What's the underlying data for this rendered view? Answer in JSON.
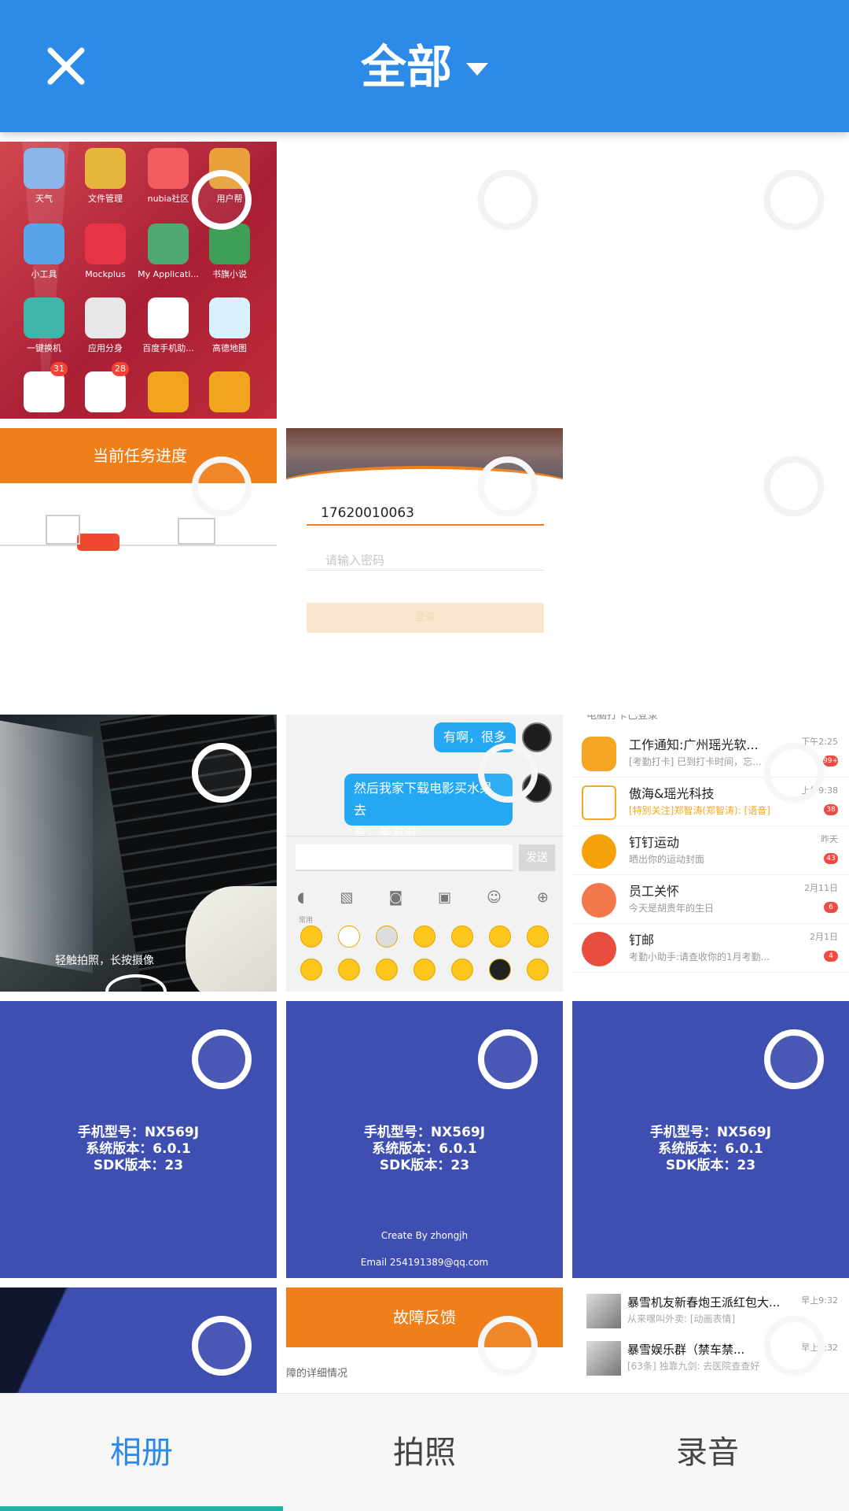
{
  "header": {
    "title": "全部"
  },
  "tiles": {
    "apps": [
      {
        "label": "天气"
      },
      {
        "label": "文件管理"
      },
      {
        "label": "nubia社区"
      },
      {
        "label": "用户帮"
      },
      {
        "label": "小工具"
      },
      {
        "label": "Mockplus"
      },
      {
        "label": "My Applicati..."
      },
      {
        "label": "书旗小说"
      },
      {
        "label": "一键换机"
      },
      {
        "label": "应用分身"
      },
      {
        "label": "百度手机助..."
      },
      {
        "label": "高德地图"
      },
      {
        "label": ""
      },
      {
        "label": ""
      },
      {
        "label": ""
      },
      {
        "label": ""
      }
    ],
    "badges": [
      "31",
      "28"
    ],
    "task": {
      "title": "当前任务进度"
    },
    "login": {
      "phone": "17620010063",
      "password_placeholder": "请输入密码",
      "button": "登录"
    },
    "photo": {
      "hint": "轻触拍照，长按摄像"
    },
    "chat": {
      "bubble1": "有啊，很多",
      "bubble2_line1": "然后我家下载电影买水果去",
      "bubble2_line2": "看，美滋滋",
      "send": "发送",
      "section": "常用"
    },
    "messages": {
      "top_cut": "电脑打卡已登录",
      "rows": [
        {
          "title": "工作通知:广州瑶光软...",
          "sub": "[考勤打卡] 已到打卡时间，忘...",
          "date": "下午2:25",
          "count": "99+"
        },
        {
          "title": "傲海&瑶光科技",
          "sub": "[特别关注]郑智涛(郑智涛): [语音]",
          "date": "上午9:38",
          "count": "38"
        },
        {
          "title": "钉钉运动",
          "sub": "晒出你的运动封面",
          "date": "昨天",
          "count": "43"
        },
        {
          "title": "员工关怀",
          "sub": "今天是胡贵年的生日",
          "date": "2月11日",
          "count": "6"
        },
        {
          "title": "钉邮",
          "sub": "考勤小助手:请查收你的1月考勤...",
          "date": "2月1日",
          "count": "4"
        }
      ]
    },
    "device": [
      {
        "line1": "手机型号：NX569J",
        "line2": "系统版本：6.0.1",
        "line3": "SDK版本：23"
      },
      {
        "line1": "手机型号：NX569J",
        "line2": "系统版本：6.0.1",
        "line3": "SDK版本：23",
        "credit": "Create By zhongjh",
        "email": "Email 254191389@qq.com"
      },
      {
        "line1": "手机型号：NX569J",
        "line2": "系统版本：6.0.1",
        "line3": "SDK版本：23"
      }
    ],
    "feedback": {
      "title": "故障反馈",
      "detail": "障的详细情况"
    },
    "group": [
      {
        "title": "暴雪机友新春炮王派红包大...",
        "sub": "从来嘿叫外卖: [动画表情]",
        "date": "早上9:32"
      },
      {
        "title": "暴雪娱乐群（禁车禁...",
        "sub": "[63条] 独靠九剑: 去医院查查好",
        "date": "早上9:32"
      }
    ]
  },
  "tabs": [
    {
      "label": "相册"
    },
    {
      "label": "拍照"
    },
    {
      "label": "录音"
    }
  ],
  "colors": {
    "primary": "#2d8ae6",
    "tab_indicator": "#18b7a5",
    "device_blue": "#3f4fb1",
    "orange": "#ef7f1a"
  }
}
